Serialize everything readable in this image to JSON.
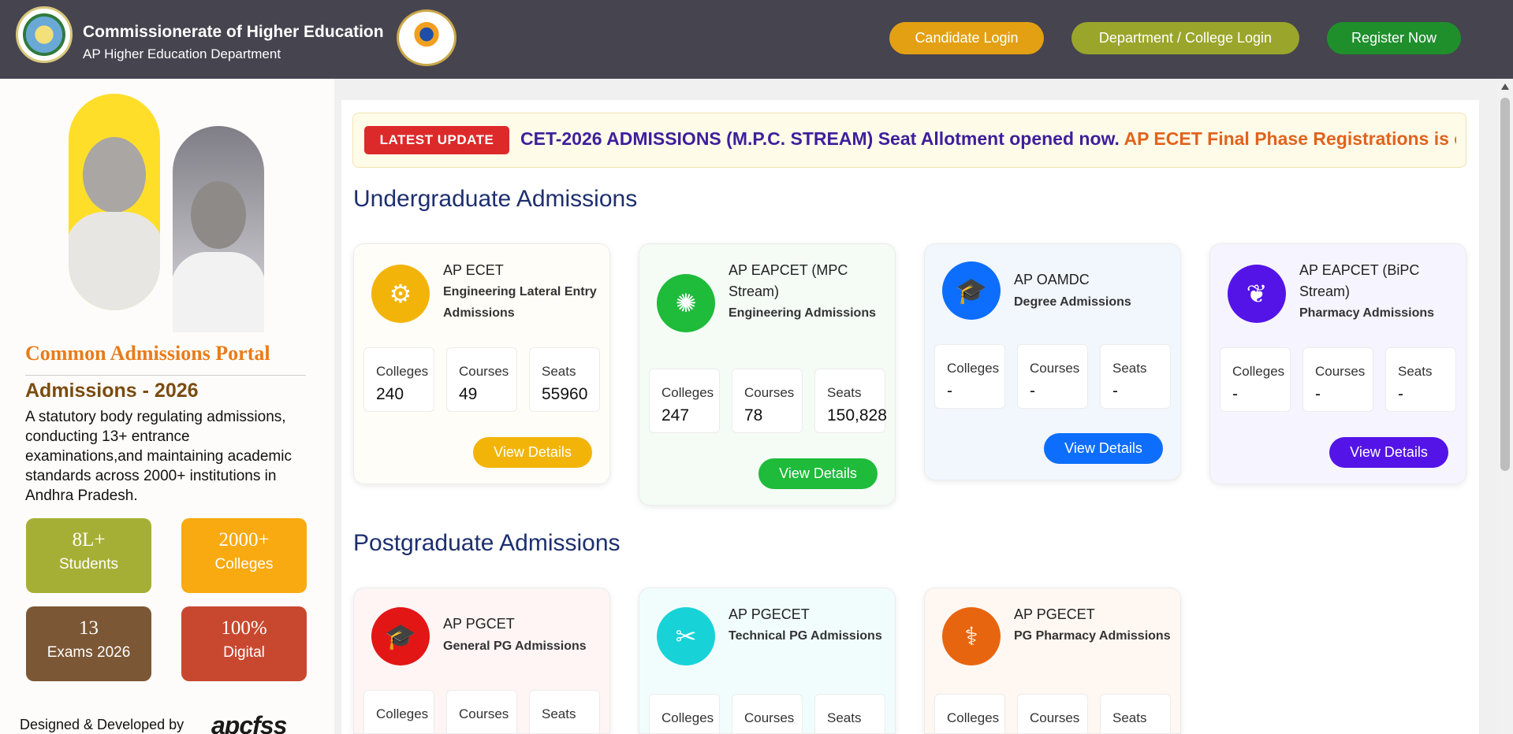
{
  "header": {
    "title": "Commissionerate of Higher Education",
    "subtitle": "AP Higher Education Department",
    "buttons": {
      "candidate": "Candidate Login",
      "department": "Department / College Login",
      "register": "Register Now"
    }
  },
  "sidebar": {
    "portal_title": "Common Admissions Portal",
    "admissions_year": "Admissions - 2026",
    "description": "A statutory body regulating admissions, conducting 13+ entrance examinations,and maintaining academic standards across 2000+ institutions in Andhra Pradesh.",
    "stats": [
      {
        "value": "8L+",
        "label": "Students",
        "color": "#a6af35"
      },
      {
        "value": "2000+",
        "label": "Colleges",
        "color": "#f8aa10"
      },
      {
        "value": "13",
        "label": "Exams 2026",
        "color": "#7b5735"
      },
      {
        "value": "100%",
        "label": "Digital",
        "color": "#c8482f"
      }
    ],
    "credit": "Designed & Developed by",
    "credit_brand": "apcfss"
  },
  "ticker": {
    "label": "LATEST UPDATE",
    "message1": "CET-2026 ADMISSIONS (M.P.C. STREAM) Seat Allotment opened now.",
    "message2": "AP ECET Final Phase Registrations is ope"
  },
  "ug": {
    "title": "Undergraduate Admissions",
    "cards": [
      {
        "name": "AP ECET",
        "desc": "Engineering Lateral Entry Admissions",
        "colleges_label": "Colleges",
        "colleges": "240",
        "courses_label": "Courses",
        "courses": "49",
        "seats_label": "Seats",
        "seats": "55960",
        "button": "View Details",
        "color": "#f3b40a",
        "icon": "engineer-icon"
      },
      {
        "name": "AP EAPCET (MPC Stream)",
        "desc": "Engineering Admissions",
        "colleges_label": "Colleges",
        "colleges": "247",
        "courses_label": "Courses",
        "courses": "78",
        "seats_label": "Seats",
        "seats": "150,828",
        "button": "View Details",
        "color": "#1fbb3a",
        "icon": "circuit-icon"
      },
      {
        "name": "AP OAMDC",
        "desc": "Degree Admissions",
        "colleges_label": "Colleges",
        "colleges": "-",
        "courses_label": "Courses",
        "courses": "-",
        "seats_label": "Seats",
        "seats": "-",
        "button": "View Details",
        "color": "#0d6efd",
        "icon": "graduation-cap-icon"
      },
      {
        "name": "AP EAPCET (BiPC Stream)",
        "desc": "Pharmacy Admissions",
        "colleges_label": "Colleges",
        "colleges": "-",
        "courses_label": "Courses",
        "courses": "-",
        "seats_label": "Seats",
        "seats": "-",
        "button": "View Details",
        "color": "#5414e8",
        "icon": "leaf-icon"
      }
    ]
  },
  "pg": {
    "title": "Postgraduate Admissions",
    "cards": [
      {
        "name": "AP PGCET",
        "desc": "General PG Admissions",
        "colleges_label": "Colleges",
        "courses_label": "Courses",
        "seats_label": "Seats",
        "color": "#e31616",
        "icon": "graduate-icon"
      },
      {
        "name": "AP PGECET",
        "desc": "Technical PG Admissions",
        "colleges_label": "Colleges",
        "courses_label": "Courses",
        "seats_label": "Seats",
        "color": "#17d3d8",
        "icon": "tools-icon"
      },
      {
        "name": "AP PGECET",
        "desc": "PG Pharmacy Admissions",
        "colleges_label": "Colleges",
        "courses_label": "Courses",
        "seats_label": "Seats",
        "color": "#e8650f",
        "icon": "caduceus-icon"
      }
    ]
  }
}
